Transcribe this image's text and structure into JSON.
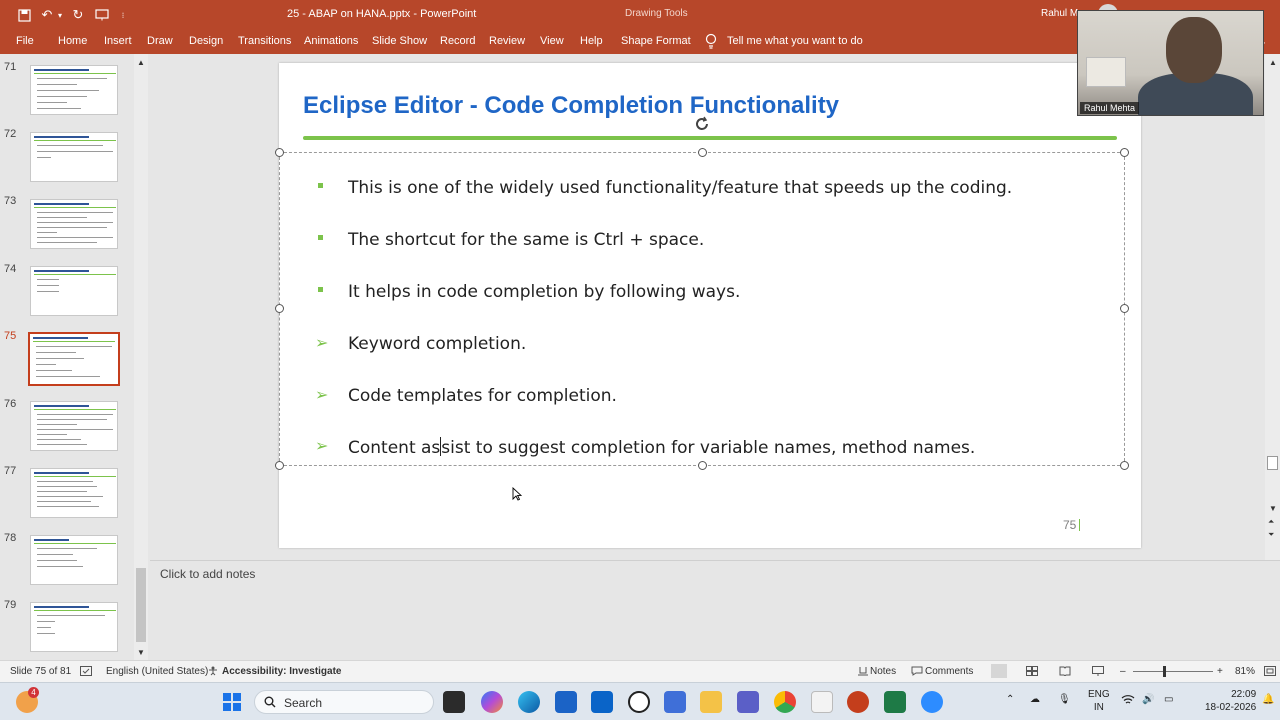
{
  "window": {
    "doc_title": "25 - ABAP on HANA.pptx  -  PowerPoint",
    "contextual_group": "Drawing Tools",
    "user_name": "Rahul Me"
  },
  "ribbon": {
    "tabs": [
      "File",
      "Home",
      "Insert",
      "Draw",
      "Design",
      "Transitions",
      "Animations",
      "Slide Show",
      "Record",
      "Review",
      "View",
      "Help",
      "Shape Format"
    ],
    "tell_me": "Tell me what you want to do"
  },
  "thumbnails": [
    {
      "number": "71"
    },
    {
      "number": "72"
    },
    {
      "number": "73"
    },
    {
      "number": "74"
    },
    {
      "number": "75",
      "active": true
    },
    {
      "number": "76"
    },
    {
      "number": "77"
    },
    {
      "number": "78"
    },
    {
      "number": "79"
    }
  ],
  "slide": {
    "title": "Eclipse Editor - Code Completion Functionality",
    "bullets": [
      {
        "style": "square",
        "text": "This is one of the widely used functionality/feature that speeds up the coding."
      },
      {
        "style": "square",
        "text": "The shortcut for the same is Ctrl + space."
      },
      {
        "style": "square",
        "text": "It helps in code completion by following ways."
      },
      {
        "style": "arrow",
        "text": "Keyword completion."
      },
      {
        "style": "arrow",
        "text": "Code templates for completion."
      },
      {
        "style": "arrow",
        "text_before_caret": "Content as",
        "text_after_caret": "sist to suggest completion for variable names, method names."
      }
    ],
    "page_number": "75",
    "accent_color": "#7cc34b",
    "title_color": "#1f66c6"
  },
  "notes": {
    "placeholder": "Click to add notes"
  },
  "webcam": {
    "label": "Rahul Mehta"
  },
  "statusbar": {
    "slide_position": "Slide 75 of 81",
    "language": "English (United States)",
    "accessibility": "Accessibility: Investigate",
    "notes_btn": "Notes",
    "comments_btn": "Comments",
    "zoom": "81%"
  },
  "taskbar": {
    "search_placeholder": "Search",
    "notification_count": "4",
    "lang_line1": "ENG",
    "lang_line2": "IN",
    "time": "22:09",
    "date": "18-02-2026"
  },
  "colors": {
    "ribbon": "#b7472a",
    "active_thumb": "#c43e1c"
  }
}
